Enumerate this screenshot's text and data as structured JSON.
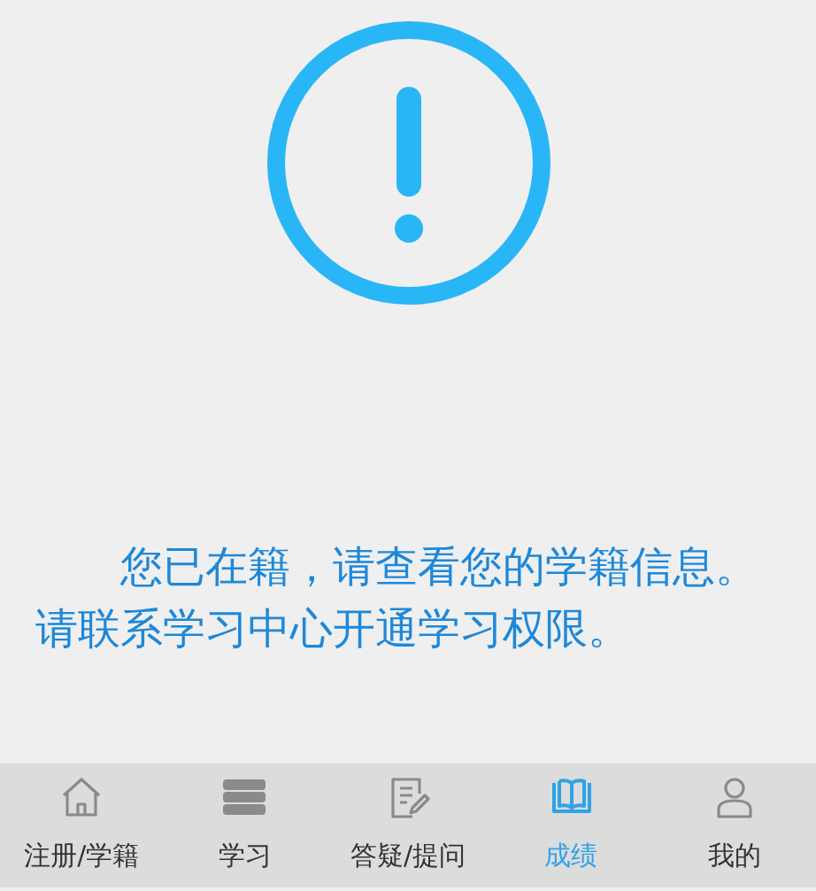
{
  "message": "您已在籍，请查看您的学籍信息。请联系学习中心开通学习权限。",
  "tabs": [
    {
      "label": "注册/学籍",
      "kind": "home",
      "selected": false
    },
    {
      "label": "学习",
      "kind": "books",
      "selected": false
    },
    {
      "label": "答疑/提问",
      "kind": "edit",
      "selected": false
    },
    {
      "label": "成绩",
      "kind": "book",
      "selected": true
    },
    {
      "label": "我的",
      "kind": "user",
      "selected": false
    }
  ]
}
